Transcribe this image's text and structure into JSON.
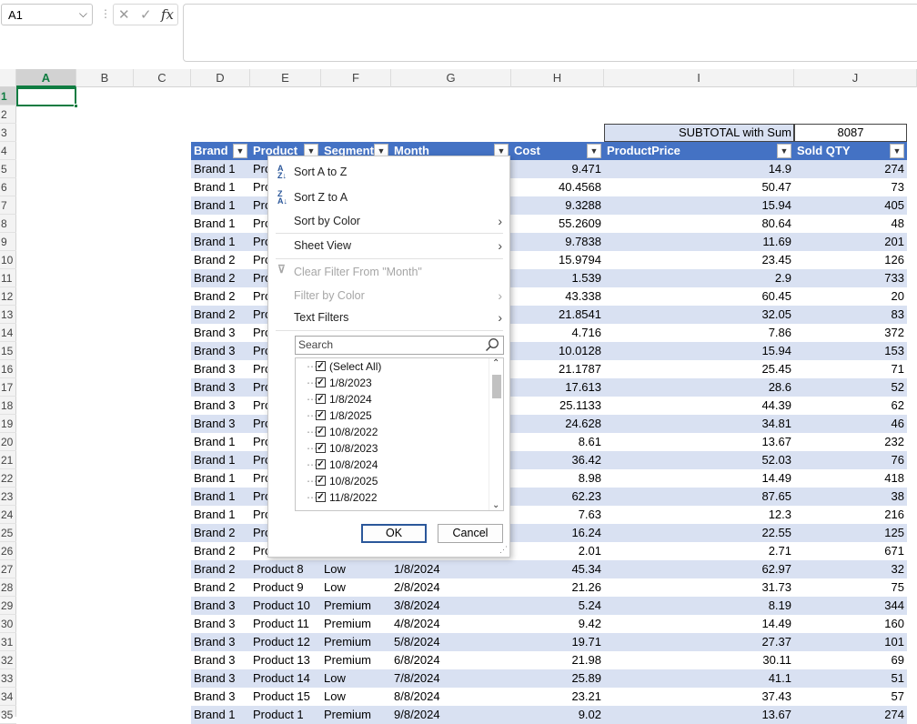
{
  "namebox": {
    "value": "A1"
  },
  "formula_bar": {
    "cancel_glyph": "✕",
    "enter_glyph": "✓",
    "fx_label": "fx",
    "content": ""
  },
  "columns": [
    "A",
    "B",
    "C",
    "D",
    "E",
    "F",
    "G",
    "H",
    "I",
    "J"
  ],
  "rows": [
    "1",
    "2",
    "3",
    "4",
    "5",
    "6",
    "7",
    "8",
    "9",
    "10",
    "11",
    "12",
    "13",
    "14",
    "15",
    "16",
    "17",
    "18",
    "19",
    "20",
    "21",
    "22",
    "23",
    "24",
    "25",
    "26",
    "27",
    "28",
    "29",
    "30",
    "31",
    "32",
    "33",
    "34",
    "35"
  ],
  "subtotal": {
    "label": "SUBTOTAL with Sum",
    "value": "8087"
  },
  "table": {
    "headers": [
      "Brand",
      "Product",
      "Segment",
      "Month",
      "Cost",
      "ProductPrice",
      "Sold QTY"
    ],
    "rows": [
      [
        "Brand 1",
        "Pro",
        "",
        "",
        "9.471",
        "14.9",
        "274"
      ],
      [
        "Brand 1",
        "Pro",
        "",
        "",
        "40.4568",
        "50.47",
        "73"
      ],
      [
        "Brand 1",
        "Pro",
        "",
        "",
        "9.3288",
        "15.94",
        "405"
      ],
      [
        "Brand 1",
        "Pro",
        "",
        "",
        "55.2609",
        "80.64",
        "48"
      ],
      [
        "Brand 1",
        "Pro",
        "",
        "",
        "9.7838",
        "11.69",
        "201"
      ],
      [
        "Brand 2",
        "Pro",
        "",
        "",
        "15.9794",
        "23.45",
        "126"
      ],
      [
        "Brand 2",
        "Pro",
        "",
        "",
        "1.539",
        "2.9",
        "733"
      ],
      [
        "Brand 2",
        "Pro",
        "",
        "",
        "43.338",
        "60.45",
        "20"
      ],
      [
        "Brand 2",
        "Pro",
        "",
        "",
        "21.8541",
        "32.05",
        "83"
      ],
      [
        "Brand 3",
        "Pro",
        "",
        "",
        "4.716",
        "7.86",
        "372"
      ],
      [
        "Brand 3",
        "Pro",
        "",
        "",
        "10.0128",
        "15.94",
        "153"
      ],
      [
        "Brand 3",
        "Pro",
        "",
        "",
        "21.1787",
        "25.45",
        "71"
      ],
      [
        "Brand 3",
        "Pro",
        "",
        "",
        "17.613",
        "28.6",
        "52"
      ],
      [
        "Brand 3",
        "Pro",
        "",
        "",
        "25.1133",
        "44.39",
        "62"
      ],
      [
        "Brand 3",
        "Pro",
        "",
        "",
        "24.628",
        "34.81",
        "46"
      ],
      [
        "Brand 1",
        "Pro",
        "",
        "",
        "8.61",
        "13.67",
        "232"
      ],
      [
        "Brand 1",
        "Pro",
        "",
        "",
        "36.42",
        "52.03",
        "76"
      ],
      [
        "Brand 1",
        "Pro",
        "",
        "",
        "8.98",
        "14.49",
        "418"
      ],
      [
        "Brand 1",
        "Pro",
        "",
        "",
        "62.23",
        "87.65",
        "38"
      ],
      [
        "Brand 1",
        "Pro",
        "",
        "",
        "7.63",
        "12.3",
        "216"
      ],
      [
        "Brand 2",
        "Pro",
        "",
        "",
        "16.24",
        "22.55",
        "125"
      ],
      [
        "Brand 2",
        "Pro",
        "",
        "",
        "2.01",
        "2.71",
        "671"
      ],
      [
        "Brand 2",
        "Product 8",
        "Low",
        "1/8/2024",
        "45.34",
        "62.97",
        "32"
      ],
      [
        "Brand 2",
        "Product 9",
        "Low",
        "2/8/2024",
        "21.26",
        "31.73",
        "75"
      ],
      [
        "Brand 3",
        "Product 10",
        "Premium",
        "3/8/2024",
        "5.24",
        "8.19",
        "344"
      ],
      [
        "Brand 3",
        "Product 11",
        "Premium",
        "4/8/2024",
        "9.42",
        "14.49",
        "160"
      ],
      [
        "Brand 3",
        "Product 12",
        "Premium",
        "5/8/2024",
        "19.71",
        "27.37",
        "101"
      ],
      [
        "Brand 3",
        "Product 13",
        "Premium",
        "6/8/2024",
        "21.98",
        "30.11",
        "69"
      ],
      [
        "Brand 3",
        "Product 14",
        "Low",
        "7/8/2024",
        "25.89",
        "41.1",
        "51"
      ],
      [
        "Brand 3",
        "Product 15",
        "Low",
        "8/8/2024",
        "23.21",
        "37.43",
        "57"
      ],
      [
        "Brand 1",
        "Product 1",
        "Premium",
        "9/8/2024",
        "9.02",
        "13.67",
        "274"
      ]
    ]
  },
  "filter_menu": {
    "sort_asc": "Sort A to Z",
    "sort_desc": "Sort Z to A",
    "sort_by_color": "Sort by Color",
    "sheet_view": "Sheet View",
    "clear_filter": "Clear Filter From \"Month\"",
    "filter_by_color": "Filter by Color",
    "text_filters": "Text Filters",
    "search_placeholder": "Search",
    "items": [
      "(Select All)",
      "1/8/2023",
      "1/8/2024",
      "1/8/2025",
      "10/8/2022",
      "10/8/2023",
      "10/8/2024",
      "10/8/2025",
      "11/8/2022"
    ],
    "ok": "OK",
    "cancel": "Cancel"
  },
  "colors": {
    "accent": "#107c41",
    "table_header": "#4472c4",
    "band": "#d9e1f2",
    "ok_border": "#2b579a"
  }
}
